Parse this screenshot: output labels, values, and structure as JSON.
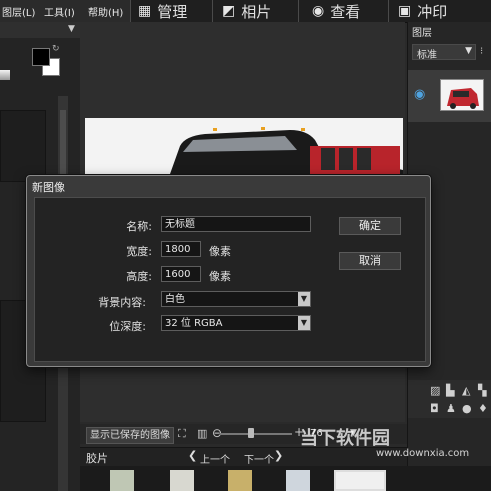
{
  "menu": {
    "items": [
      "图层(L)",
      "工具(I)",
      "帮助(H)"
    ]
  },
  "modes": [
    {
      "label": "管理",
      "icon": "grid-icon"
    },
    {
      "label": "相片",
      "icon": "photo-edit-icon"
    },
    {
      "label": "查看",
      "icon": "eye-icon"
    },
    {
      "label": "冲印",
      "icon": "print-icon"
    }
  ],
  "layers": {
    "title": "图层",
    "blend_mode": "标准"
  },
  "dialog": {
    "title": "新图像",
    "name_label": "名称:",
    "name_value": "无标题",
    "width_label": "宽度:",
    "width_value": "1800",
    "width_unit": "像素",
    "height_label": "高度:",
    "height_value": "1600",
    "height_unit": "像素",
    "bg_label": "背景内容:",
    "bg_value": "白色",
    "depth_label": "位深度:",
    "depth_value": "32 位 RGBA",
    "ok": "确定",
    "cancel": "取消"
  },
  "bottom": {
    "show_saved": "显示已保存的图像",
    "zoom": "76",
    "filmstrip_label": "胶片",
    "prev": "上一个",
    "next": "下一个"
  },
  "watermark": {
    "text": "当下软件园",
    "url": "www.downxia.com"
  }
}
